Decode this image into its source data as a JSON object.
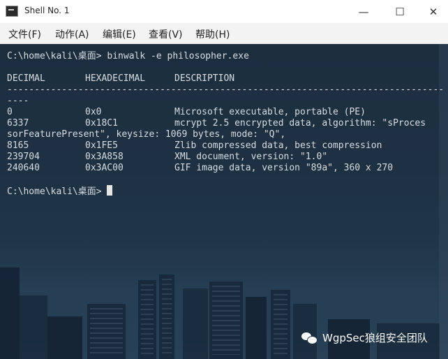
{
  "window": {
    "title": "Shell No. 1",
    "controls": {
      "minimize": "—",
      "maximize": "☐",
      "close": "✕"
    }
  },
  "menu": {
    "items": [
      {
        "label": "文件(F)"
      },
      {
        "label": "动作(A)"
      },
      {
        "label": "编辑(E)"
      },
      {
        "label": "查看(V)"
      },
      {
        "label": "帮助(H)"
      }
    ]
  },
  "terminal": {
    "command_line": "C:\\home\\kali\\桌面> binwalk -e philosopher.exe",
    "headers": [
      "DECIMAL",
      "HEXADECIMAL",
      "DESCRIPTION"
    ],
    "separator1": "--------------------------------------------------------------------------------",
    "separator2": "----",
    "rows": [
      {
        "decimal": "0",
        "hex": "0x0",
        "desc": "Microsoft executable, portable (PE)"
      },
      {
        "decimal": "6337",
        "hex": "0x18C1",
        "desc": "mcrypt 2.5 encrypted data, algorithm: \"sProces"
      },
      {
        "decimal": "8165",
        "hex": "0x1FE5",
        "desc": "Zlib compressed data, best compression"
      },
      {
        "decimal": "239704",
        "hex": "0x3A858",
        "desc": "XML document, version: \"1.0\""
      },
      {
        "decimal": "240640",
        "hex": "0x3AC00",
        "desc": "GIF image data, version \"89a\", 360 x 270"
      }
    ],
    "wrap_line": "sorFeaturePresent\", keysize: 1069 bytes, mode: \"Q\",",
    "prompt": "C:\\home\\kali\\桌面> "
  },
  "watermark": {
    "text": "WgpSec狼组安全团队"
  }
}
